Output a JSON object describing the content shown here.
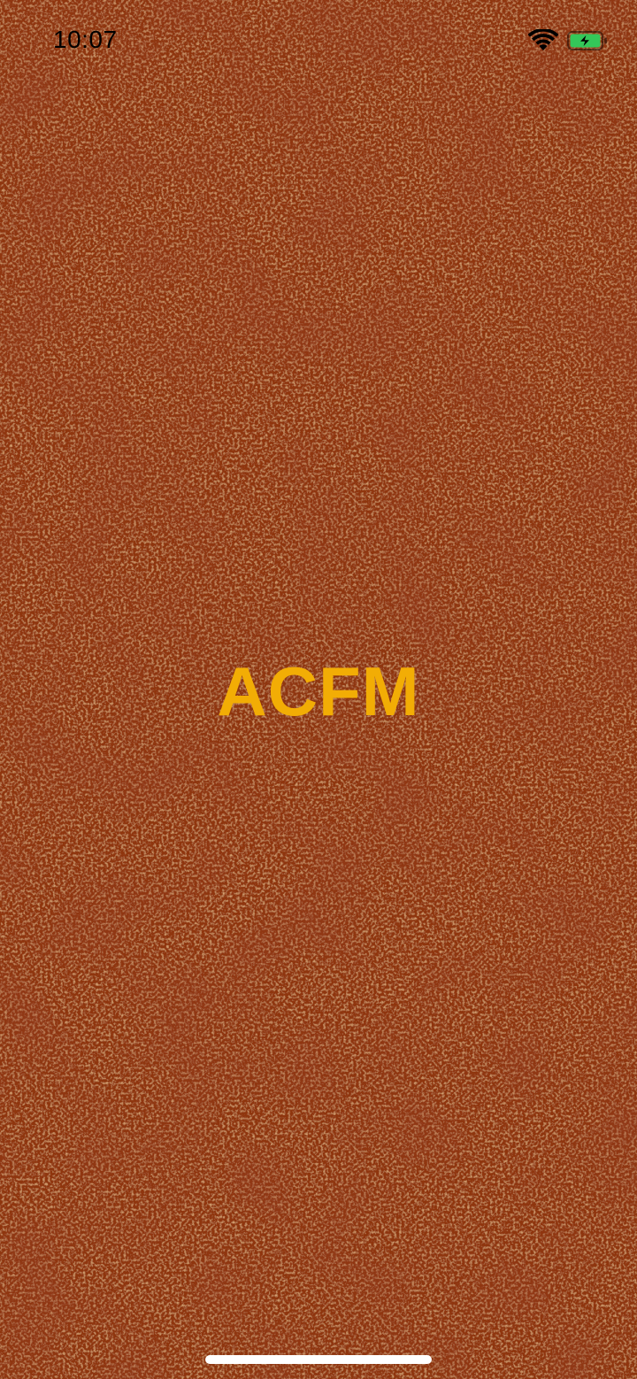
{
  "status_bar": {
    "time": "10:07",
    "wifi_icon": "wifi-icon",
    "battery_icon": "battery-charging-icon",
    "text_color": "#000000",
    "battery_color": "#34c759"
  },
  "splash": {
    "logo_text": "ACFM",
    "logo_color": "#f2ad05",
    "background_color": "#8f3410",
    "background_texture": "sand-grain"
  },
  "home_indicator": {
    "color": "#ffffff"
  }
}
